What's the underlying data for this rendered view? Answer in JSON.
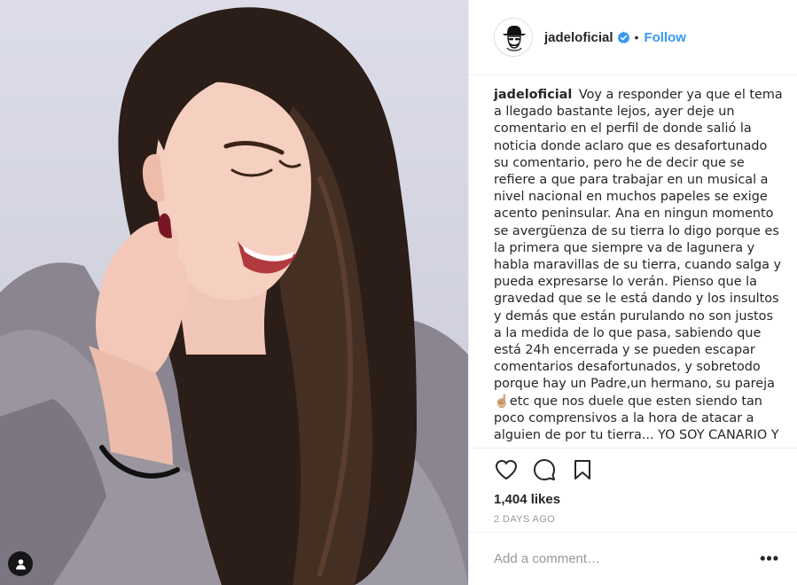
{
  "header": {
    "username": "jadeloficial",
    "separator": "•",
    "follow_label": "Follow",
    "avatar_icon": "hat-avatar-icon",
    "verified_icon": "verified-badge-icon"
  },
  "caption": {
    "username": "jadeloficial",
    "text": "Voy a responder ya que el tema a llegado bastante lejos, ayer deje un comentario en el perfil de donde salió la noticia donde aclaro que es desafortunado su comentario, pero he de decir que se refiere a que para trabajar en un musical a nivel nacional en muchos papeles se exige acento peninsular. Ana en ningun momento se avergüenza de su tierra lo digo porque es la primera que siempre va de lagunera y habla maravillas de su tierra, cuando salga y pueda expresarse lo verán. Pienso que la gravedad que se le está dando y los insultos y demás que están purulando no son justos a la medida de lo que pasa, sabiendo que está 24h encerrada y se pueden escapar comentarios desafortunados, y sobretodo porque hay un Padre,un hermano, su pareja☝🏼etc que nos duele que esten siendo tan poco comprensivos a la hora de atacar a alguien de por tu tierra... YO SOY CANARIO Y"
  },
  "actions": {
    "like_icon": "heart-icon",
    "comment_icon": "comment-bubble-icon",
    "save_icon": "bookmark-icon",
    "likes": "1,404 likes",
    "timestamp": "2 DAYS AGO"
  },
  "comment_box": {
    "placeholder": "Add a comment…",
    "more_label": "•••"
  },
  "photo": {
    "tag_icon": "user-tag-icon"
  },
  "colors": {
    "accent": "#3897f0",
    "text": "#262626",
    "muted": "#999999",
    "border": "#efefef"
  }
}
